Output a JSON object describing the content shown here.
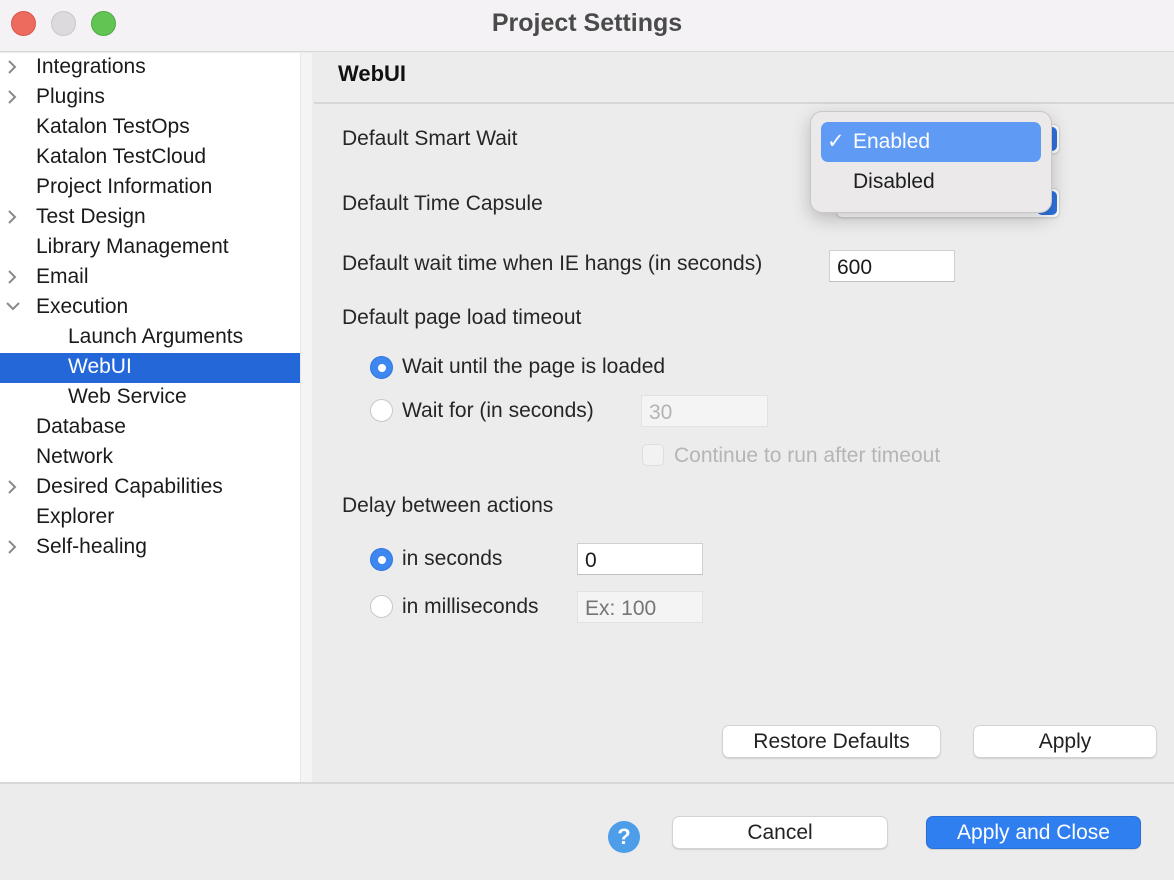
{
  "window": {
    "title": "Project Settings"
  },
  "sidebar": {
    "items": [
      {
        "label": "Integrations",
        "expander": "collapsed",
        "level": 0
      },
      {
        "label": "Plugins",
        "expander": "collapsed",
        "level": 0
      },
      {
        "label": "Katalon TestOps",
        "expander": "none",
        "level": 0
      },
      {
        "label": "Katalon TestCloud",
        "expander": "none",
        "level": 0
      },
      {
        "label": "Project Information",
        "expander": "none",
        "level": 0
      },
      {
        "label": "Test Design",
        "expander": "collapsed",
        "level": 0
      },
      {
        "label": "Library Management",
        "expander": "none",
        "level": 0
      },
      {
        "label": "Email",
        "expander": "collapsed",
        "level": 0
      },
      {
        "label": "Execution",
        "expander": "expanded",
        "level": 0
      },
      {
        "label": "Launch Arguments",
        "expander": "none",
        "level": 1
      },
      {
        "label": "WebUI",
        "expander": "none",
        "level": 1,
        "selected": true
      },
      {
        "label": "Web Service",
        "expander": "none",
        "level": 1
      },
      {
        "label": "Database",
        "expander": "none",
        "level": 0
      },
      {
        "label": "Network",
        "expander": "none",
        "level": 0
      },
      {
        "label": "Desired Capabilities",
        "expander": "collapsed",
        "level": 0
      },
      {
        "label": "Explorer",
        "expander": "none",
        "level": 0
      },
      {
        "label": "Self-healing",
        "expander": "collapsed",
        "level": 0
      }
    ]
  },
  "page": {
    "title": "WebUI",
    "smart_wait": {
      "label": "Default Smart Wait",
      "options": [
        "Enabled",
        "Disabled"
      ],
      "selected": "Enabled"
    },
    "time_capsule": {
      "label": "Default Time Capsule"
    },
    "ie_hang": {
      "label": "Default wait time when IE hangs (in seconds)",
      "value": "600"
    },
    "page_load": {
      "label": "Default page load timeout",
      "option_loaded": "Wait until the page is loaded",
      "option_wait_for": "Wait for (in seconds)",
      "wait_for_value": "30",
      "continue_label": "Continue to run after timeout",
      "selected": "loaded"
    },
    "delay": {
      "label": "Delay between actions",
      "option_seconds": "in seconds",
      "seconds_value": "0",
      "option_ms": "in milliseconds",
      "ms_placeholder": "Ex: 100",
      "selected": "seconds"
    },
    "buttons": {
      "restore_defaults": "Restore Defaults",
      "apply": "Apply"
    }
  },
  "footer": {
    "help": "?",
    "cancel": "Cancel",
    "apply_and_close": "Apply and Close"
  },
  "colors": {
    "selection": "#2467d9",
    "accent": "#2f7ff0",
    "menu_highlight": "#5f9bf5"
  }
}
